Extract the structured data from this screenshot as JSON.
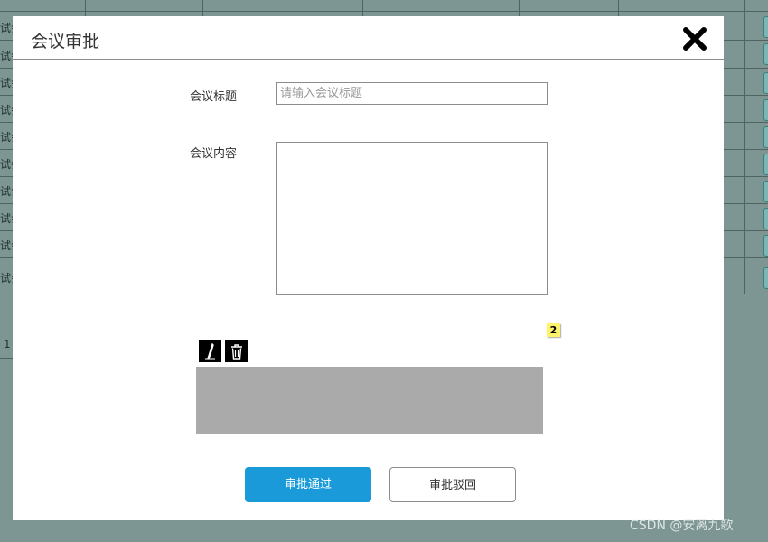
{
  "background": {
    "row_fragments": [
      "试会",
      "试会",
      "试会",
      "试会",
      "试会",
      "试会",
      "试会",
      "试会",
      "试会",
      "试会"
    ],
    "page_number": "1"
  },
  "dialog": {
    "title": "会议审批",
    "fields": {
      "title_label": "会议标题",
      "title_placeholder": "请输入会议标题",
      "content_label": "会议内容"
    },
    "badge": "2",
    "buttons": {
      "approve": "审批通过",
      "reject": "审批驳回"
    }
  },
  "watermark": "CSDN @安离九歌",
  "colors": {
    "backdrop": "#7d9693",
    "primary": "#1a9ad9",
    "signature_area": "#aaaaaa",
    "badge": "#fff36b"
  },
  "icons": [
    "close-icon",
    "pen-icon",
    "trash-icon"
  ]
}
